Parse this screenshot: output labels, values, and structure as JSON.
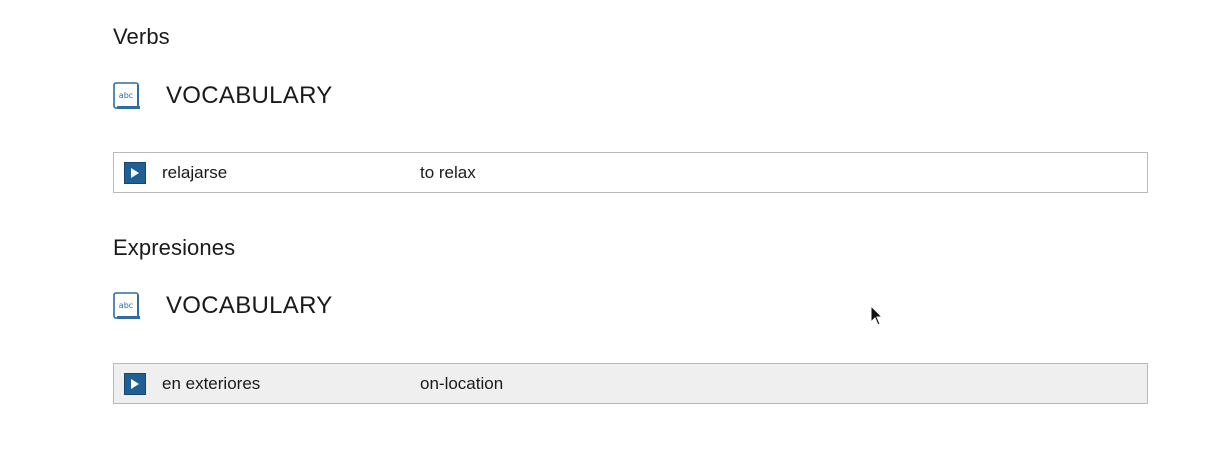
{
  "sections": [
    {
      "heading": "Verbs",
      "vocab_title": "VOCABULARY",
      "icon": "abc-book-icon",
      "rows": [
        {
          "term": "relajarse",
          "translation": "to relax",
          "icon": "play-icon"
        }
      ]
    },
    {
      "heading": "Expresiones",
      "vocab_title": "VOCABULARY",
      "icon": "abc-book-icon",
      "rows": [
        {
          "term": "en exteriores",
          "translation": "on-location",
          "icon": "play-icon"
        }
      ]
    }
  ],
  "icon_text": "abc",
  "colors": {
    "play_button": "#1f5f93",
    "row_border": "#b9b9b9",
    "row_hover_bg": "#efefef",
    "icon_blue": "#2d6da3"
  }
}
